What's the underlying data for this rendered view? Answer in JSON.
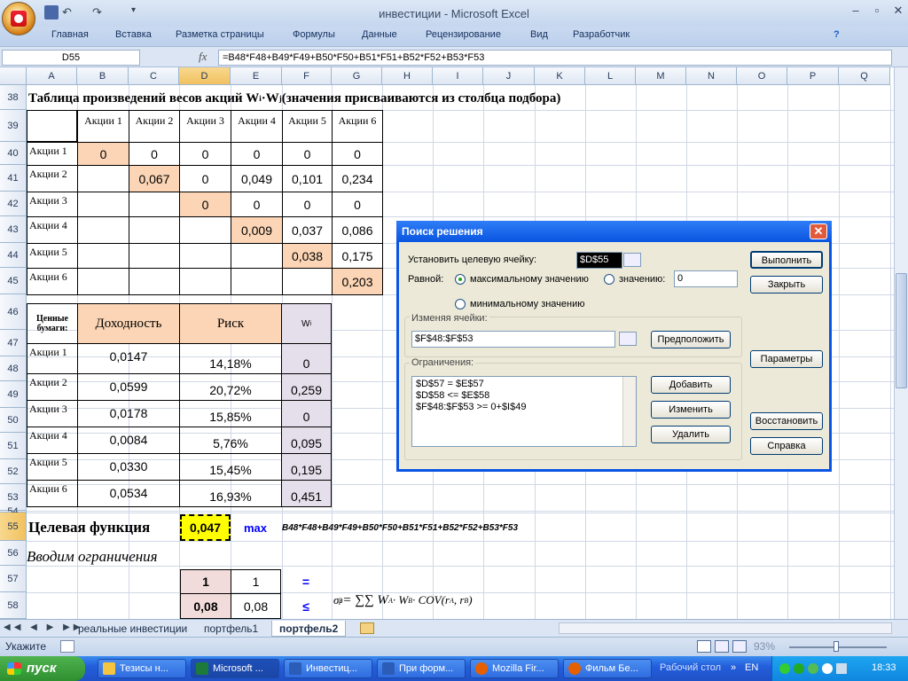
{
  "window": {
    "title": "инвестиции - Microsoft Excel",
    "minimize": "–",
    "restore": "▫",
    "close": "✕"
  },
  "ribbon": {
    "tabs": [
      "Главная",
      "Вставка",
      "Разметка страницы",
      "Формулы",
      "Данные",
      "Рецензирование",
      "Вид",
      "Разработчик"
    ]
  },
  "formula_bar": {
    "name_box": "D55",
    "fx": "fx",
    "formula": "=B48*F48+B49*F49+B50*F50+B51*F51+B52*F52+B53*F53"
  },
  "columns": [
    "A",
    "B",
    "C",
    "D",
    "E",
    "F",
    "G",
    "H",
    "I",
    "J",
    "K",
    "L",
    "M",
    "N",
    "O",
    "P",
    "Q"
  ],
  "rows": [
    "38",
    "39",
    "40",
    "41",
    "42",
    "43",
    "44",
    "45",
    "46",
    "47",
    "48",
    "49",
    "50",
    "51",
    "52",
    "53",
    "54",
    "55",
    "56",
    "57",
    "58"
  ],
  "sheet": {
    "title38": "Таблица произведений весов акций W",
    "title38_sub_i": "i",
    "title38_dot": "·W",
    "title38_sub_j": "j",
    "title38_rest": " (значения присваиваются из столбца подбора)",
    "matrix_headers": [
      "Акции 1",
      "Акции 2",
      "Акции 3",
      "Акции 4",
      "Акции 5",
      "Акции 6"
    ],
    "matrix_rows": [
      {
        "label": "Акции 1",
        "values": [
          "0",
          "0",
          "0",
          "0",
          "0",
          "0"
        ]
      },
      {
        "label": "Акции 2",
        "values": [
          "",
          "0,067",
          "0",
          "0,049",
          "0,101",
          "0,234"
        ]
      },
      {
        "label": "Акции 3",
        "values": [
          "",
          "",
          "0",
          "0",
          "0",
          "0"
        ]
      },
      {
        "label": "Акции 4",
        "values": [
          "",
          "",
          "",
          "0,009",
          "0,037",
          "0,086"
        ]
      },
      {
        "label": "Акции 5",
        "values": [
          "",
          "",
          "",
          "",
          "0,038",
          "0,175"
        ]
      },
      {
        "label": "Акции 6",
        "values": [
          "",
          "",
          "",
          "",
          "",
          "0,203"
        ]
      }
    ],
    "sec_header": "Ценные бумаги:",
    "col_return": "Доходность",
    "col_risk": "Риск",
    "col_w": "W",
    "col_w_sub": "i",
    "securities": [
      {
        "label": "Акции 1",
        "ret": "0,0147",
        "risk": "14,18%",
        "w": "0"
      },
      {
        "label": "Акции 2",
        "ret": "0,0599",
        "risk": "20,72%",
        "w": "0,259"
      },
      {
        "label": "Акции 3",
        "ret": "0,0178",
        "risk": "15,85%",
        "w": "0"
      },
      {
        "label": "Акции 4",
        "ret": "0,0084",
        "risk": "5,76%",
        "w": "0,095"
      },
      {
        "label": "Акции 5",
        "ret": "0,0330",
        "risk": "15,45%",
        "w": "0,195"
      },
      {
        "label": "Акции 6",
        "ret": "0,0534",
        "risk": "16,93%",
        "w": "0,451"
      }
    ],
    "target_label": "Целевая функция",
    "target_value": "0,047",
    "target_max": "max",
    "target_formula": "B48*F48+B49*F49+B50*F50+B51*F51+B52*F52+B53*F53",
    "constraints_label": "Вводим ограничения",
    "r57": {
      "d": "1",
      "e": "1",
      "sym": "="
    },
    "r58": {
      "d": "0,08",
      "e": "0,08",
      "sym": "≤"
    },
    "eq_sigma": "σ",
    "eq_sub": "p",
    "eq_sup": "2",
    "eq_rest": " = ∑∑ W",
    "eq_a": "A",
    "eq_dot": " · W",
    "eq_b": "B",
    "eq_cov": " · COV(r",
    "eq_ra": "A",
    "eq_comma": ", r",
    "eq_rb": "B",
    "eq_close": ")"
  },
  "dialog": {
    "title": "Поиск решения",
    "set_target_label": "Установить целевую ячейку:",
    "target_cell": "$D$55",
    "equal_label": "Равной:",
    "opt_max": "максимальному значению",
    "opt_value": "значению:",
    "value_input": "0",
    "opt_min": "минимальному значению",
    "changing_label": "Изменяя ячейки:",
    "changing_value": "$F$48:$F$53",
    "constraints_label": "Ограничения:",
    "constraints": [
      "$D$57 = $E$57",
      "$D$58 <= $E$58",
      "$F$48:$F$53 >= 0+$I$49"
    ],
    "btn_solve": "Выполнить",
    "btn_close": "Закрыть",
    "btn_guess": "Предположить",
    "btn_params": "Параметры",
    "btn_add": "Добавить",
    "btn_change": "Изменить",
    "btn_delete": "Удалить",
    "btn_reset": "Восстановить",
    "btn_help": "Справка"
  },
  "sheet_tabs": [
    "реальные инвестиции",
    "портфель1",
    "портфель2"
  ],
  "active_sheet": "портфель2",
  "status": {
    "mode": "Укажите",
    "zoom": "93%"
  },
  "taskbar": {
    "start": "пуск",
    "tasks": [
      "Тезисы н...",
      "Microsoft ...",
      "Инвестиц...",
      "При форм...",
      "Mozilla Fir...",
      "Фильм Бе..."
    ],
    "desktop": "Рабочий стол",
    "lang": "EN",
    "time": "18:33"
  },
  "colors": {
    "orange": "#fbd5b5",
    "lavender": "#e5dfec",
    "yellow": "#ffff00",
    "accent_blue": "#0000ff"
  }
}
